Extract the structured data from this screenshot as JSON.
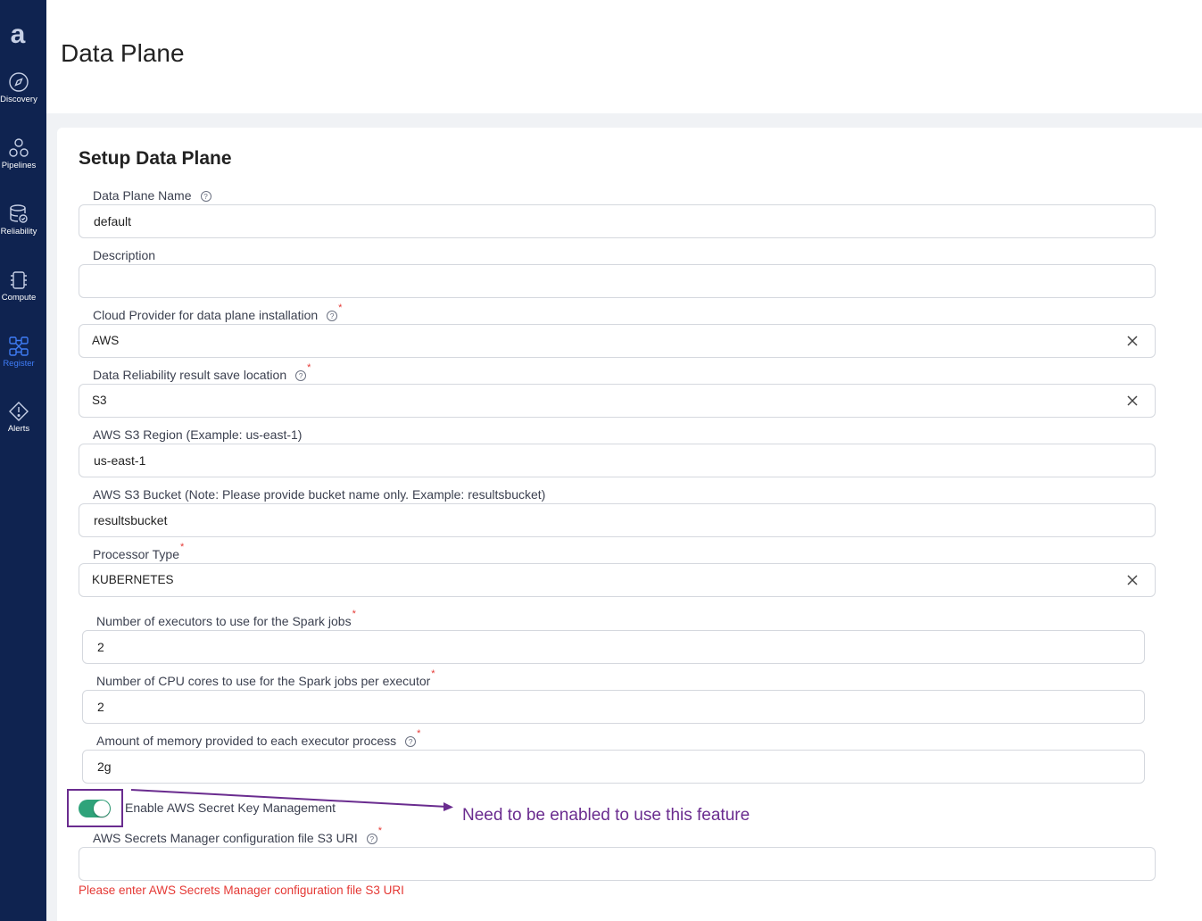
{
  "sidebar": {
    "logo": "a",
    "items": [
      {
        "label": "Discovery",
        "icon": "compass-icon"
      },
      {
        "label": "Pipelines",
        "icon": "pipelines-icon"
      },
      {
        "label": "Reliability",
        "icon": "database-check-icon"
      },
      {
        "label": "Compute",
        "icon": "chip-icon"
      },
      {
        "label": "Register",
        "icon": "register-network-icon",
        "active": true
      },
      {
        "label": "Alerts",
        "icon": "alert-diamond-icon"
      }
    ]
  },
  "header": {
    "title": "Data Plane"
  },
  "form": {
    "title": "Setup Data Plane",
    "data_plane_name": {
      "label": "Data Plane Name",
      "value": "default"
    },
    "description": {
      "label": "Description",
      "value": ""
    },
    "cloud_provider": {
      "label": "Cloud Provider for data plane installation",
      "value": "AWS"
    },
    "result_location": {
      "label": "Data Reliability result save location",
      "value": "S3"
    },
    "s3_region": {
      "label": "AWS S3 Region (Example: us-east-1)",
      "value": "us-east-1"
    },
    "s3_bucket": {
      "label": "AWS S3 Bucket (Note: Please provide bucket name only. Example: resultsbucket)",
      "value": "resultsbucket"
    },
    "processor_type": {
      "label": "Processor Type",
      "value": "KUBERNETES"
    },
    "executors": {
      "label": "Number of executors to use for the Spark jobs",
      "value": "2"
    },
    "cpu_cores": {
      "label": "Number of CPU cores to use for the Spark jobs per executor",
      "value": "2"
    },
    "memory": {
      "label": "Amount of memory provided to each executor process",
      "value": "2g"
    },
    "secret_key_toggle": {
      "label": "Enable AWS Secret Key Management",
      "enabled": true
    },
    "secrets_config_uri": {
      "label": "AWS Secrets Manager configuration file S3 URI",
      "value": "",
      "error": "Please enter AWS Secrets Manager configuration file S3 URI"
    }
  },
  "annotation": {
    "text": "Need to be enabled to use this feature",
    "color": "#6a2c8f"
  },
  "colors": {
    "sidebar": "#0f2350",
    "accent": "#3f7cf6",
    "toggle_on": "#2fa37a",
    "error": "#e53935"
  }
}
